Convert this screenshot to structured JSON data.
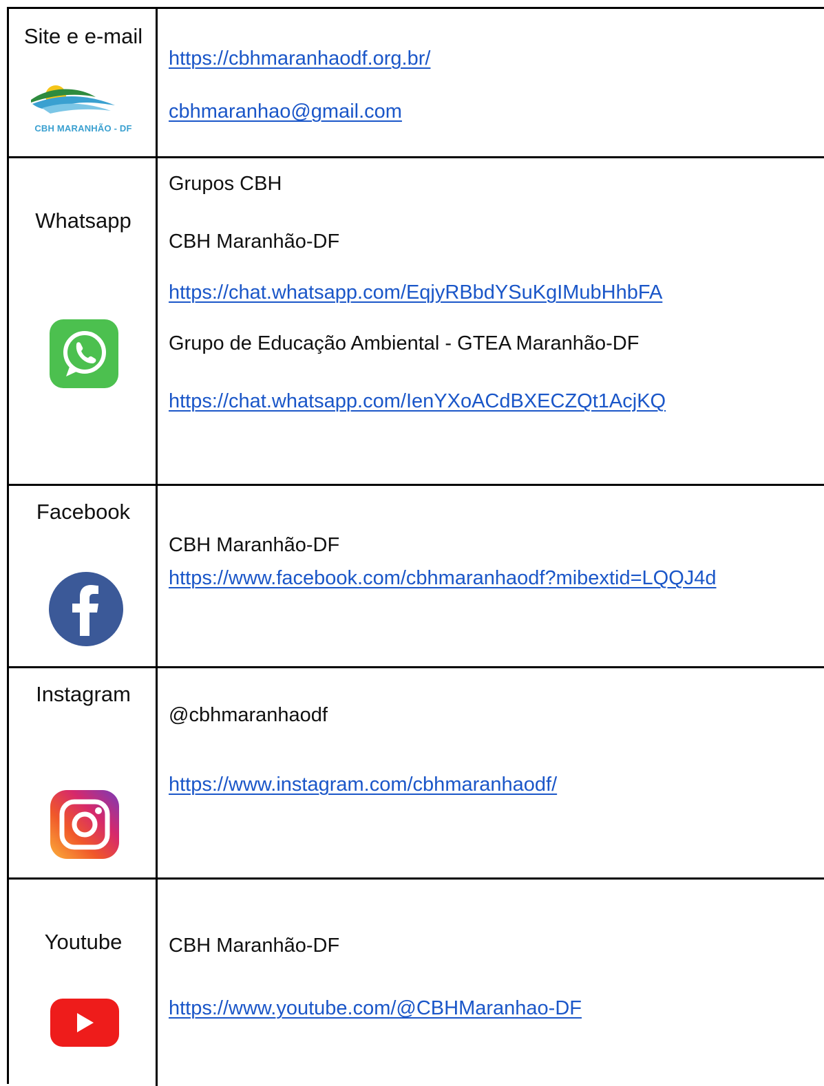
{
  "rows": [
    {
      "label": "Site e e-mail",
      "logo_caption": "CBH MARANHÃO - DF",
      "site_url": "https://cbhmaranhaodf.org.br/",
      "email": "cbhmaranhao@gmail.com"
    },
    {
      "label": "Whatsapp",
      "heading": "Grupos CBH",
      "group1_name": "CBH Maranhão-DF",
      "group1_url": "https://chat.whatsapp.com/EqjyRBbdYSuKgIMubHhbFA",
      "group2_name": "Grupo de Educação Ambiental - GTEA Maranhão-DF",
      "group2_url": "https://chat.whatsapp.com/IenYXoACdBXECZQt1AcjKQ"
    },
    {
      "label": "Facebook",
      "name": "CBH Maranhão-DF",
      "url": "https://www.facebook.com/cbhmaranhaodf?mibextid=LQQJ4d"
    },
    {
      "label": "Instagram",
      "handle": "@cbhmaranhaodf",
      "url": "https://www.instagram.com/cbhmaranhaodf/"
    },
    {
      "label": "Youtube",
      "name": "CBH Maranhão-DF",
      "url": "https://www.youtube.com/@CBHMaranhao-DF"
    }
  ],
  "icons": {
    "site": "cbh-maranhao-logo",
    "whatsapp": "whatsapp-icon",
    "facebook": "facebook-icon",
    "instagram": "instagram-icon",
    "youtube": "youtube-icon"
  },
  "colors": {
    "link": "#1a56c8",
    "whatsapp": "#4cc04f",
    "facebook": "#3b5998",
    "youtube": "#ee1c1b"
  }
}
